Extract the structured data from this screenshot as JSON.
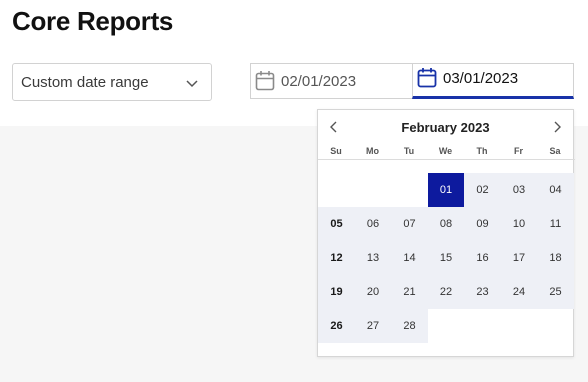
{
  "page": {
    "title": "Core Reports"
  },
  "filter": {
    "range_select_value": "Custom date range",
    "start_date": "02/01/2023",
    "end_date": "03/01/2023"
  },
  "calendar": {
    "month_title": "February 2023",
    "weekdays": [
      "Su",
      "Mo",
      "Tu",
      "We",
      "Th",
      "Fr",
      "Sa"
    ],
    "first_weekday_index": 3,
    "days": [
      "01",
      "02",
      "03",
      "04",
      "05",
      "06",
      "07",
      "08",
      "09",
      "10",
      "11",
      "12",
      "13",
      "14",
      "15",
      "16",
      "17",
      "18",
      "19",
      "20",
      "21",
      "22",
      "23",
      "24",
      "25",
      "26",
      "27",
      "28"
    ],
    "selected_day": "01",
    "bold_days": [
      "05",
      "12",
      "19",
      "26"
    ]
  },
  "colors": {
    "accent": "#0d1a9e",
    "active_underline": "#1832a8",
    "icon_blue": "#1832a8",
    "icon_gray": "#8a8a8a"
  }
}
